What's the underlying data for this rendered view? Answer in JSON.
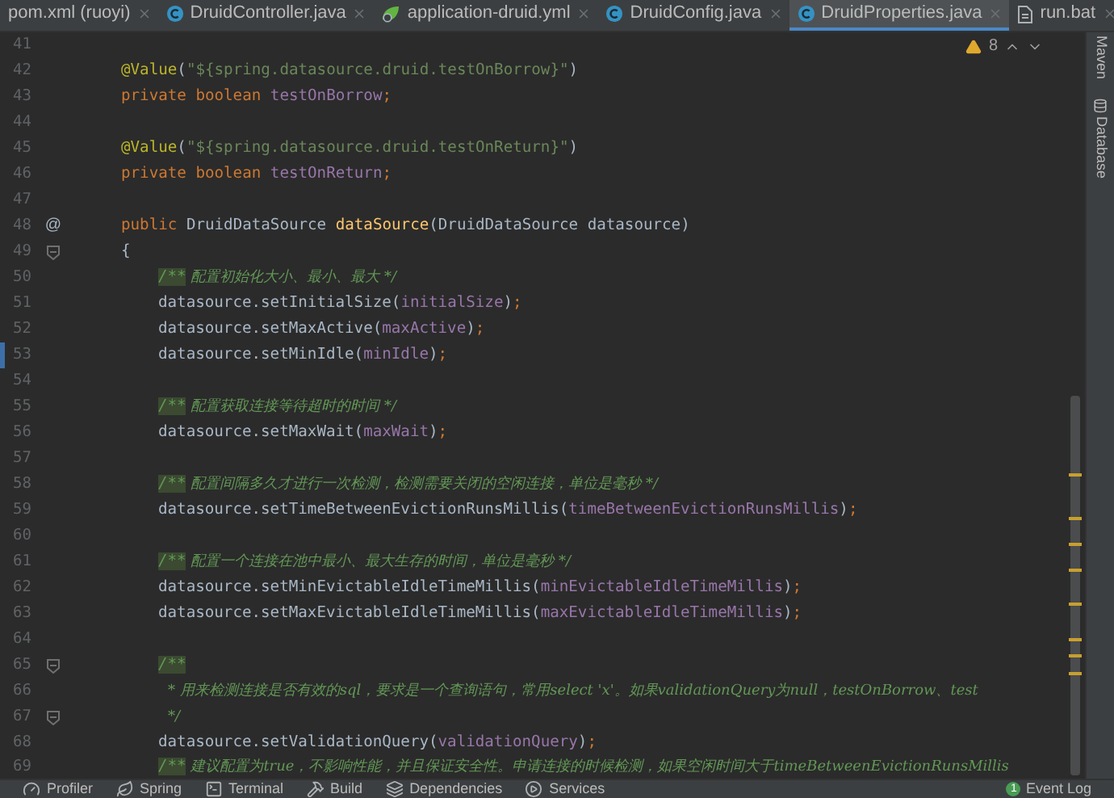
{
  "tabs": [
    {
      "label": "pom.xml (ruoyi)",
      "kind": "plain",
      "selected": false
    },
    {
      "label": "DruidController.java",
      "kind": "class",
      "selected": false
    },
    {
      "label": "application-druid.yml",
      "kind": "yml",
      "selected": false
    },
    {
      "label": "DruidConfig.java",
      "kind": "class",
      "selected": false
    },
    {
      "label": "DruidProperties.java",
      "kind": "class",
      "selected": true
    },
    {
      "label": "run.bat",
      "kind": "bat",
      "selected": false
    }
  ],
  "editor": {
    "inspection": {
      "count": "8"
    },
    "lines": [
      {
        "number": "41",
        "fold": false,
        "changed": false
      },
      {
        "number": "42",
        "kind": "member",
        "fold": false,
        "changed": false,
        "tokens": [
          {
            "text": "@Value",
            "kind": "annotation"
          },
          {
            "text": "(",
            "kind": "plain"
          },
          {
            "text": "\"${spring.datasource.druid.testOnBorrow}\"",
            "kind": "string"
          },
          {
            "text": ")",
            "kind": "plain"
          }
        ]
      },
      {
        "number": "43",
        "kind": "member",
        "fold": false,
        "changed": false,
        "tokens": [
          {
            "text": "private boolean ",
            "kind": "keyword"
          },
          {
            "text": "testOnBorrow",
            "kind": "field"
          },
          {
            "text": ";",
            "kind": "keyword"
          }
        ]
      },
      {
        "number": "44",
        "fold": false,
        "changed": false
      },
      {
        "number": "45",
        "kind": "member",
        "fold": false,
        "changed": false,
        "tokens": [
          {
            "text": "@Value",
            "kind": "annotation"
          },
          {
            "text": "(",
            "kind": "plain"
          },
          {
            "text": "\"${spring.datasource.druid.testOnReturn}\"",
            "kind": "string"
          },
          {
            "text": ")",
            "kind": "plain"
          }
        ]
      },
      {
        "number": "46",
        "kind": "member",
        "fold": false,
        "changed": false,
        "tokens": [
          {
            "text": "private boolean ",
            "kind": "keyword"
          },
          {
            "text": "testOnReturn",
            "kind": "field"
          },
          {
            "text": ";",
            "kind": "keyword"
          }
        ]
      },
      {
        "number": "47",
        "fold": false,
        "changed": false
      },
      {
        "number": "48",
        "kind": "member",
        "gutter_text": "@",
        "fold": false,
        "changed": false,
        "tokens": [
          {
            "text": "public ",
            "kind": "keyword"
          },
          {
            "text": "DruidDataSource ",
            "kind": "plain"
          },
          {
            "text": "dataSource",
            "kind": "method"
          },
          {
            "text": "(DruidDataSource datasource)",
            "kind": "plain"
          }
        ]
      },
      {
        "number": "49",
        "kind": "member",
        "fold": true,
        "changed": false,
        "tokens": [
          {
            "text": "{",
            "kind": "plain"
          }
        ]
      },
      {
        "number": "50",
        "kind": "body",
        "fold": false,
        "changed": false,
        "tokens": [
          {
            "text": "/**",
            "kind": "docmark"
          },
          {
            "text": " 配置初始化大小、最小、最大 */",
            "kind": "doc"
          }
        ]
      },
      {
        "number": "51",
        "kind": "body",
        "fold": false,
        "changed": false,
        "tokens": [
          {
            "text": "datasource.setInitialSize(",
            "kind": "plain"
          },
          {
            "text": "initialSize",
            "kind": "field"
          },
          {
            "text": ")",
            "kind": "plain"
          },
          {
            "text": ";",
            "kind": "keyword"
          }
        ]
      },
      {
        "number": "52",
        "kind": "body",
        "fold": false,
        "changed": false,
        "tokens": [
          {
            "text": "datasource.setMaxActive(",
            "kind": "plain"
          },
          {
            "text": "maxActive",
            "kind": "field"
          },
          {
            "text": ")",
            "kind": "plain"
          },
          {
            "text": ";",
            "kind": "keyword"
          }
        ]
      },
      {
        "number": "53",
        "kind": "body",
        "fold": false,
        "changed": true,
        "tokens": [
          {
            "text": "datasource.setMinIdle(",
            "kind": "plain"
          },
          {
            "text": "minIdle",
            "kind": "field"
          },
          {
            "text": ")",
            "kind": "plain"
          },
          {
            "text": ";",
            "kind": "keyword"
          }
        ]
      },
      {
        "number": "54",
        "fold": false,
        "changed": false
      },
      {
        "number": "55",
        "kind": "body",
        "fold": false,
        "changed": false,
        "tokens": [
          {
            "text": "/**",
            "kind": "docmark"
          },
          {
            "text": " 配置获取连接等待超时的时间 */",
            "kind": "doc"
          }
        ]
      },
      {
        "number": "56",
        "kind": "body",
        "fold": false,
        "changed": false,
        "tokens": [
          {
            "text": "datasource.setMaxWait(",
            "kind": "plain"
          },
          {
            "text": "maxWait",
            "kind": "field"
          },
          {
            "text": ")",
            "kind": "plain"
          },
          {
            "text": ";",
            "kind": "keyword"
          }
        ]
      },
      {
        "number": "57",
        "fold": false,
        "changed": false
      },
      {
        "number": "58",
        "kind": "body",
        "fold": false,
        "changed": false,
        "tokens": [
          {
            "text": "/**",
            "kind": "docmark"
          },
          {
            "text": " 配置间隔多久才进行一次检测，检测需要关闭的空闲连接，单位是毫秒 */",
            "kind": "doc"
          }
        ]
      },
      {
        "number": "59",
        "kind": "body",
        "fold": false,
        "changed": false,
        "tokens": [
          {
            "text": "datasource.setTimeBetweenEvictionRunsMillis(",
            "kind": "plain"
          },
          {
            "text": "timeBetweenEvictionRunsMillis",
            "kind": "field"
          },
          {
            "text": ")",
            "kind": "plain"
          },
          {
            "text": ";",
            "kind": "keyword"
          }
        ]
      },
      {
        "number": "60",
        "fold": false,
        "changed": false
      },
      {
        "number": "61",
        "kind": "body",
        "fold": false,
        "changed": false,
        "tokens": [
          {
            "text": "/**",
            "kind": "docmark"
          },
          {
            "text": " 配置一个连接在池中最小、最大生存的时间，单位是毫秒 */",
            "kind": "doc"
          }
        ]
      },
      {
        "number": "62",
        "kind": "body",
        "fold": false,
        "changed": false,
        "tokens": [
          {
            "text": "datasource.setMinEvictableIdleTimeMillis(",
            "kind": "plain"
          },
          {
            "text": "minEvictableIdleTimeMillis",
            "kind": "field"
          },
          {
            "text": ")",
            "kind": "plain"
          },
          {
            "text": ";",
            "kind": "keyword"
          }
        ]
      },
      {
        "number": "63",
        "kind": "body",
        "fold": false,
        "changed": false,
        "tokens": [
          {
            "text": "datasource.setMaxEvictableIdleTimeMillis(",
            "kind": "plain"
          },
          {
            "text": "maxEvictableIdleTimeMillis",
            "kind": "field"
          },
          {
            "text": ")",
            "kind": "plain"
          },
          {
            "text": ";",
            "kind": "keyword"
          }
        ]
      },
      {
        "number": "64",
        "fold": false,
        "changed": false
      },
      {
        "number": "65",
        "kind": "body",
        "fold": true,
        "changed": false,
        "tokens": [
          {
            "text": "/**",
            "kind": "docmark"
          }
        ]
      },
      {
        "number": "66",
        "kind": "doc",
        "fold": false,
        "changed": false,
        "tokens": [
          {
            "text": "* 用来检测连接是否有效的sql，要求是一个查询语句，常用select 'x'。如果validationQuery为null，testOnBorrow、test",
            "kind": "doc"
          }
        ]
      },
      {
        "number": "67",
        "kind": "doc",
        "fold": true,
        "changed": false,
        "tokens": [
          {
            "text": "*/",
            "kind": "doc"
          }
        ]
      },
      {
        "number": "68",
        "kind": "body",
        "fold": false,
        "changed": false,
        "tokens": [
          {
            "text": "datasource.setValidationQuery(",
            "kind": "plain"
          },
          {
            "text": "validationQuery",
            "kind": "field"
          },
          {
            "text": ")",
            "kind": "plain"
          },
          {
            "text": ";",
            "kind": "keyword"
          }
        ]
      },
      {
        "number": "69",
        "kind": "body",
        "fold": false,
        "changed": false,
        "tokens": [
          {
            "text": "/**",
            "kind": "docmark"
          },
          {
            "text": " 建议配置为true，不影响性能，并且保证安全性。申请连接的时候检测，如果空闲时间大于timeBetweenEvictionRunsMillis",
            "kind": "doc"
          }
        ]
      }
    ]
  },
  "tool_windows": [
    "Maven",
    "Database"
  ],
  "status_bar": {
    "items": [
      {
        "label": "Profiler",
        "kind": "profiler"
      },
      {
        "label": "Spring",
        "kind": "spring"
      },
      {
        "label": "Terminal",
        "kind": "terminal"
      },
      {
        "label": "Build",
        "kind": "build"
      },
      {
        "label": "Dependencies",
        "kind": "dependencies"
      },
      {
        "label": "Services",
        "kind": "services"
      }
    ],
    "event_log": {
      "label": "Event Log",
      "badge": "1"
    }
  }
}
